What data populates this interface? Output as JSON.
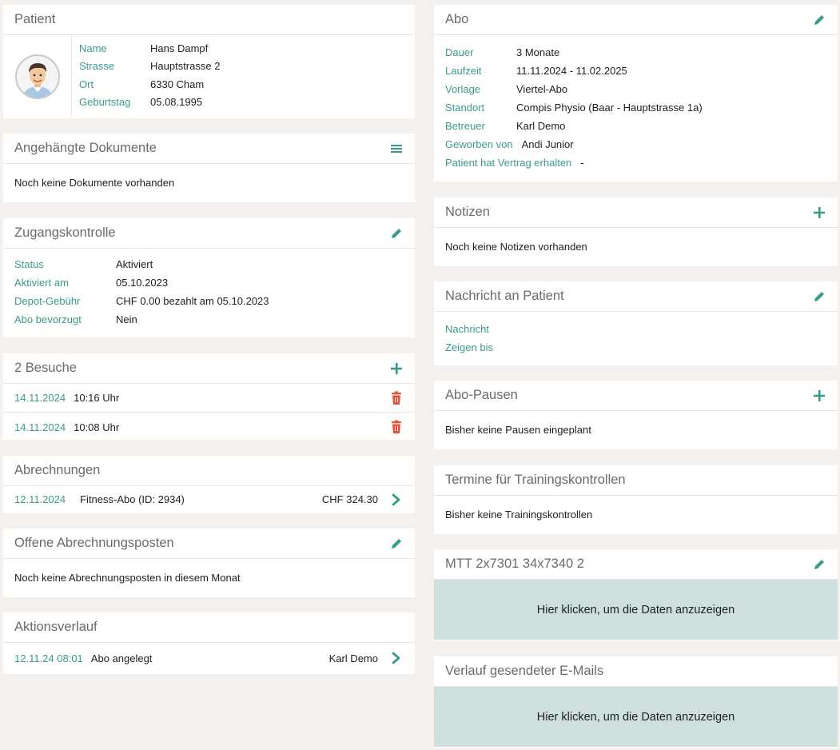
{
  "colors": {
    "accent": "#3a9a8c",
    "delete": "#e5533d",
    "panel": "#cde0dd",
    "background": "#f3f0ed"
  },
  "patient": {
    "title": "Patient",
    "fields": [
      {
        "label": "Name",
        "value": "Hans Dampf"
      },
      {
        "label": "Strasse",
        "value": "Hauptstrasse 2"
      },
      {
        "label": "Ort",
        "value": "6330 Cham"
      },
      {
        "label": "Geburtstag",
        "value": "05.08.1995"
      }
    ]
  },
  "documents": {
    "title": "Angehängte Dokumente",
    "icon": "menu-icon",
    "empty": "Noch keine Dokumente vorhanden"
  },
  "access": {
    "title": "Zugangskontrolle",
    "icon": "pencil-icon",
    "fields": [
      {
        "label": "Status",
        "value": "Aktiviert"
      },
      {
        "label": "Aktiviert am",
        "value": "05.10.2023"
      },
      {
        "label": "Depot-Gebühr",
        "value": "CHF 0.00 bezahlt am 05.10.2023"
      },
      {
        "label": "Abo bevorzugt",
        "value": "Nein"
      }
    ]
  },
  "visits": {
    "title": "2 Besuche",
    "icon": "plus-icon",
    "rows": [
      {
        "date": "14.11.2024",
        "time": "10:16 Uhr",
        "icon": "trash-icon"
      },
      {
        "date": "14.11.2024",
        "time": "10:08 Uhr",
        "icon": "trash-icon"
      }
    ]
  },
  "billing": {
    "title": "Abrechnungen",
    "rows": [
      {
        "date": "12.11.2024",
        "desc": "Fitness-Abo (ID: 2934)",
        "amount": "CHF 324.30",
        "icon": "chevron-right-icon"
      }
    ]
  },
  "open_items": {
    "title": "Offene Abrechnungsposten",
    "icon": "pencil-icon",
    "empty": "Noch keine Abrechnungsposten in diesem Monat"
  },
  "history": {
    "title": "Aktionsverlauf",
    "rows": [
      {
        "date": "12.11.24 08:01",
        "action": "Abo angelegt",
        "user": "Karl Demo",
        "icon": "chevron-right-icon"
      }
    ]
  },
  "abo": {
    "title": "Abo",
    "icon": "pencil-icon",
    "fields": [
      {
        "label": "Dauer",
        "value": "3 Monate"
      },
      {
        "label": "Laufzeit",
        "value": "11.11.2024 - 11.02.2025"
      },
      {
        "label": "Vorlage",
        "value": "Viertel-Abo"
      },
      {
        "label": "Standort",
        "value": "Compis Physio (Baar - Hauptstrasse 1a)"
      },
      {
        "label": "Betreuer",
        "value": "Karl Demo"
      },
      {
        "label": "Geworben von",
        "value": "Andi Junior"
      },
      {
        "label": "Patient hat Vertrag erhalten",
        "value": "-"
      }
    ]
  },
  "notes": {
    "title": "Notizen",
    "icon": "plus-icon",
    "empty": "Noch keine Notizen vorhanden"
  },
  "message": {
    "title": "Nachricht an Patient",
    "icon": "pencil-icon",
    "fields": [
      {
        "label": "Nachricht",
        "value": ""
      },
      {
        "label": "Zeigen bis",
        "value": ""
      }
    ]
  },
  "pauses": {
    "title": "Abo-Pausen",
    "icon": "plus-icon",
    "empty": "Bisher keine Pausen eingeplant"
  },
  "training": {
    "title": "Termine für Trainingskontrollen",
    "empty": "Bisher keine Trainingskontrollen"
  },
  "mtt": {
    "title": "MTT 2x7301 34x7340 2",
    "icon": "pencil-icon",
    "action": "Hier klicken, um die Daten anzuzeigen"
  },
  "emails": {
    "title": "Verlauf gesendeter E-Mails",
    "action": "Hier klicken, um die Daten anzuzeigen"
  }
}
